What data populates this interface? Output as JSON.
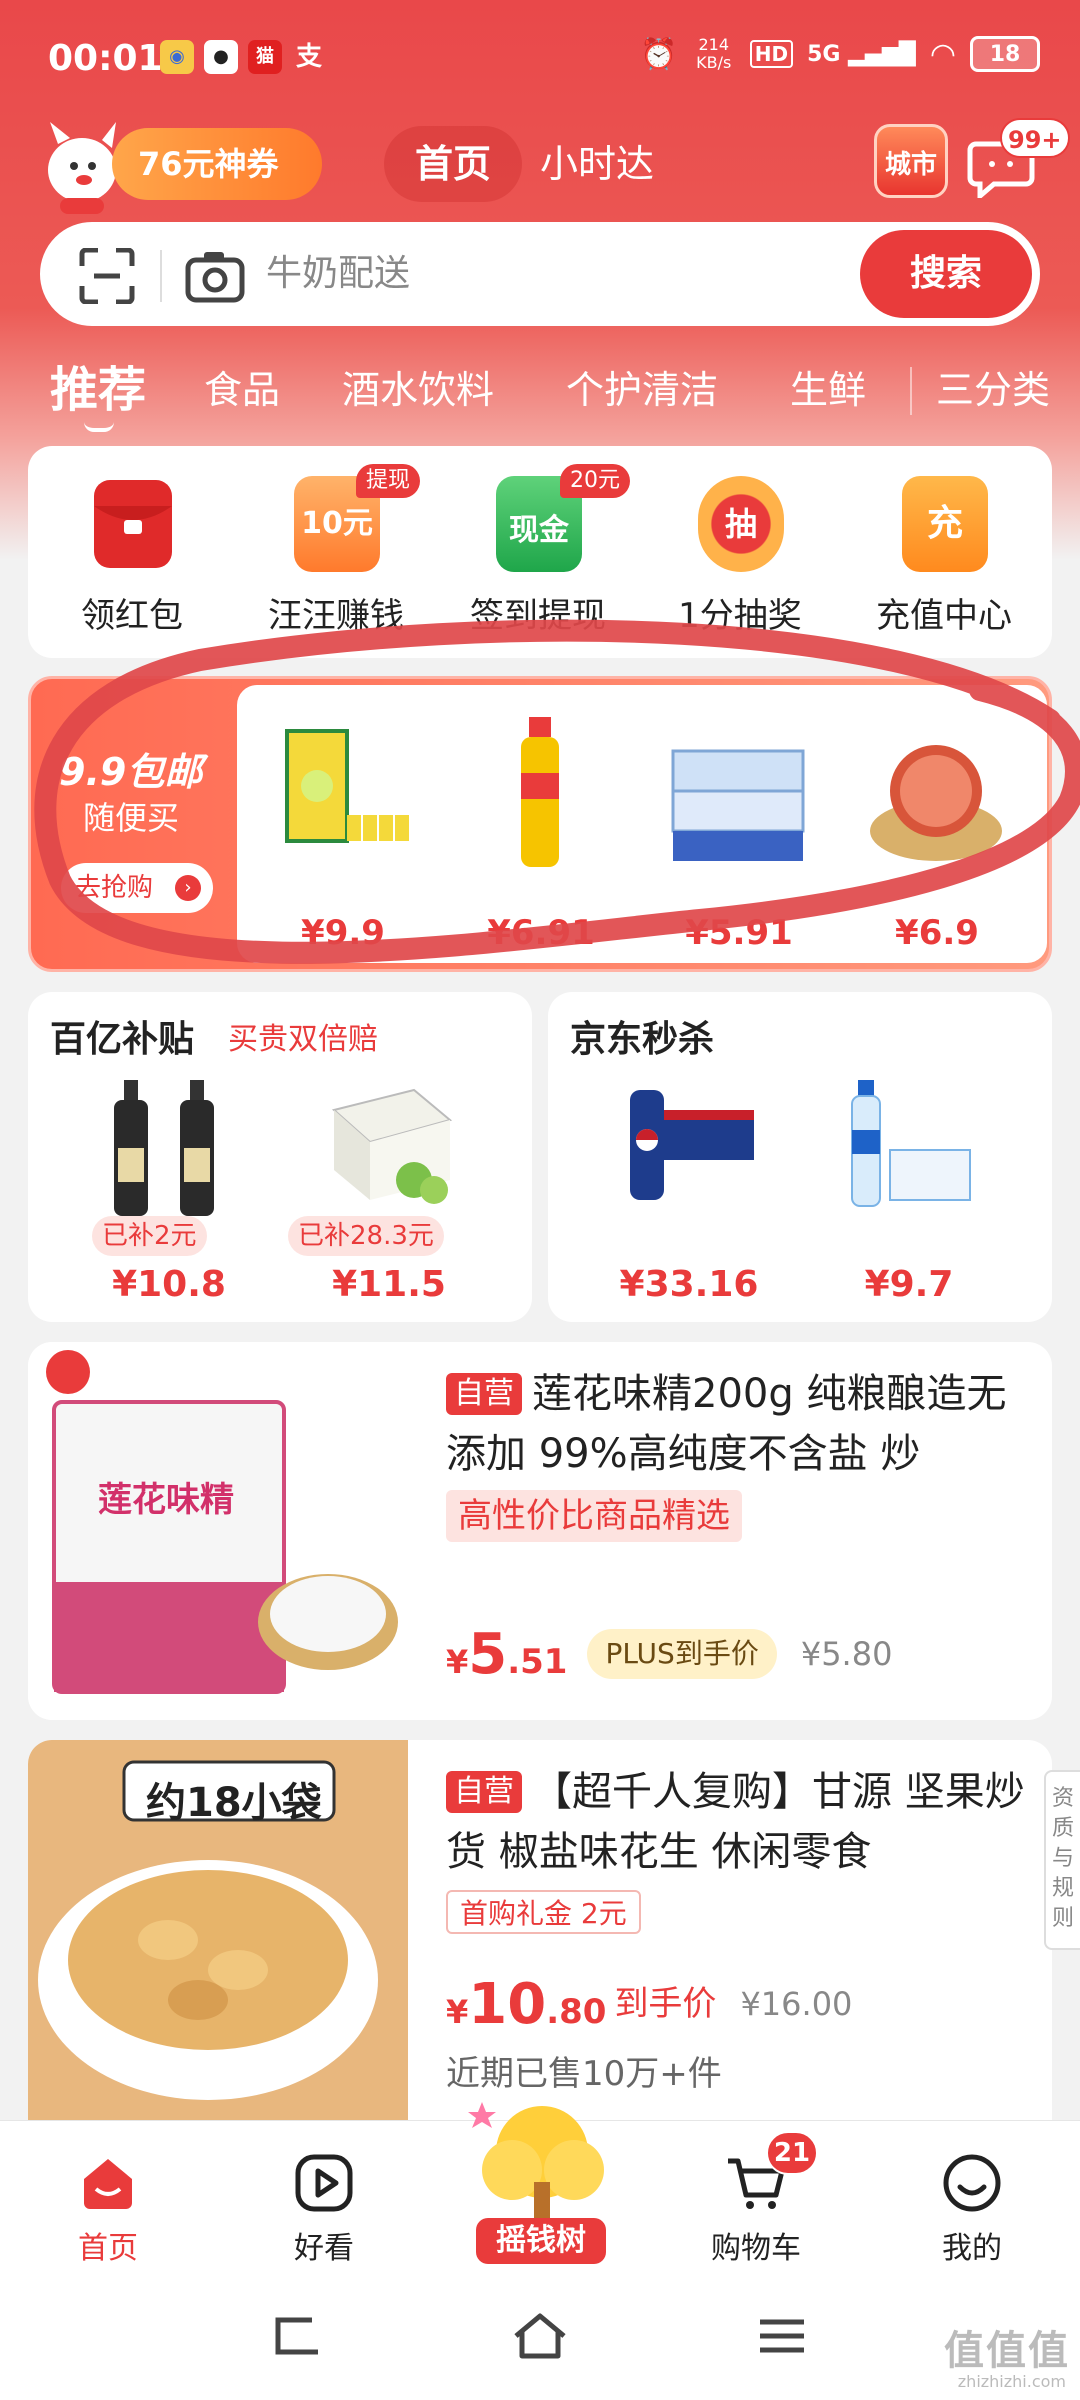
{
  "status": {
    "time": "00:01",
    "net_speed": "214 KB/s",
    "net_type": "5G",
    "battery": "18",
    "hd": "HD"
  },
  "header": {
    "coupon": "76元神券",
    "tab_home": "首页",
    "tab_hour": "小时达",
    "city": "城市",
    "msg_badge": "99+"
  },
  "search": {
    "placeholder": "牛奶配送",
    "button": "搜索"
  },
  "categories": {
    "items": [
      "推荐",
      "食品",
      "酒水饮料",
      "个护清洁",
      "生鲜"
    ],
    "more": "三分类"
  },
  "quick": [
    {
      "label": "领红包",
      "tag": ""
    },
    {
      "label": "汪汪赚钱",
      "tag": "提现",
      "icon_text": "10元"
    },
    {
      "label": "签到提现",
      "tag": "20元",
      "icon_text": "现金"
    },
    {
      "label": "1分抽奖",
      "tag": "",
      "icon_text": "抽"
    },
    {
      "label": "充值中心",
      "tag": "",
      "icon_text": "充"
    }
  ],
  "deal": {
    "title": "9.9包邮",
    "subtitle": "随便买",
    "button": "去抢购",
    "items": [
      {
        "price": "¥9.9"
      },
      {
        "price": "¥6.91"
      },
      {
        "price": "¥5.91"
      },
      {
        "price": "¥6.9"
      }
    ]
  },
  "subsidy": {
    "title": "百亿补贴",
    "subtitle": "买贵双倍赔",
    "items": [
      {
        "tag": "已补2元",
        "price": "¥10.8"
      },
      {
        "tag": "已补28.3元",
        "price": "¥11.5"
      }
    ]
  },
  "seckill": {
    "title": "京东秒杀",
    "items": [
      {
        "price": "¥33.16"
      },
      {
        "price": "¥9.7"
      }
    ]
  },
  "products": [
    {
      "badge": "自营",
      "title": "莲花味精200g 纯粮酿造无添加 99%高纯度不含盐 炒",
      "tag": "高性价比商品精选",
      "price_yen": "¥",
      "price_int": "5",
      "price_dec": ".51",
      "plus": "PLUS到手价",
      "orig": "¥5.80",
      "image_text": "莲花味精"
    },
    {
      "badge": "自营",
      "title": "【超千人复购】甘源 坚果炒货 椒盐味花生 休闲零食",
      "tag": "首购礼金 2元",
      "price_yen": "¥",
      "price_int": "10",
      "price_dec": ".80",
      "daoshou": "到手价",
      "orig": "¥16.00",
      "sold": "近期已售10万+件",
      "image_text": "约18小袋"
    }
  ],
  "side_tab": "资质与规则",
  "bottom_nav": [
    {
      "label": "首页"
    },
    {
      "label": "好看"
    },
    {
      "label": "摇钱树"
    },
    {
      "label": "购物车",
      "badge": "21"
    },
    {
      "label": "我的"
    }
  ],
  "watermark": {
    "main": "值值值",
    "sub": "zhizhizhi.com"
  },
  "colors": {
    "brand_red": "#e93b3b",
    "annotation": "#e0484a"
  }
}
